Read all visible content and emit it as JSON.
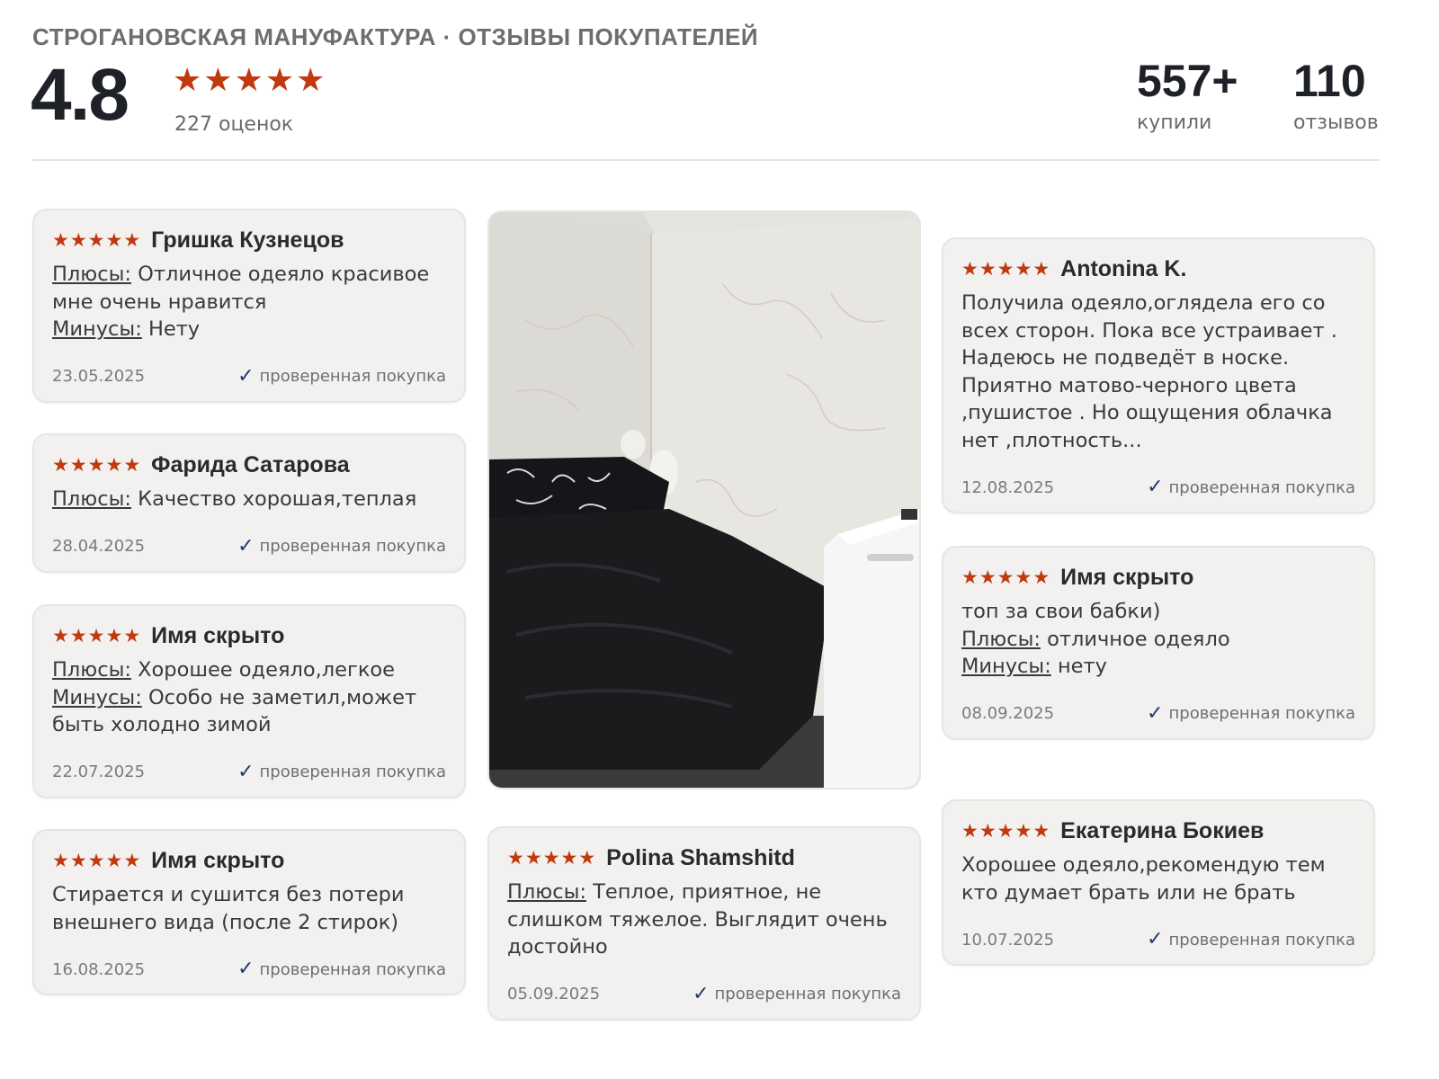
{
  "header": {
    "brand_title": "СТРОГАНОВСКАЯ МАНУФАКТУРА · ОТЗЫВЫ ПОКУПАТЕЛЕЙ",
    "score": "4.8",
    "score_stars": 5,
    "ratings_count": "227 оценок",
    "bought_value": "557+",
    "bought_label": "купили",
    "reviews_value": "110",
    "reviews_label": "отзывов"
  },
  "labels": {
    "pros": "Плюсы:",
    "cons": "Минусы:",
    "verified": "проверенная покупка"
  },
  "colors": {
    "star": "#c0390f",
    "check": "#1e3a6e",
    "card_bg": "#f2f1ef"
  },
  "reviews": [
    {
      "author": "Гришка Кузнецов",
      "stars": 5,
      "pros": "Отличное одеяло красивое мне очень нравится",
      "cons": "Нету",
      "date": "23.05.2025"
    },
    {
      "author": "Фарида Сатарова",
      "stars": 5,
      "pros": "Качество хорошая,теплая",
      "date": "28.04.2025"
    },
    {
      "author": "Имя скрыто",
      "stars": 5,
      "pros": "Хорошее одеяло,легкое",
      "cons": "Особо не заметил,может быть холодно зимой",
      "date": "22.07.2025"
    },
    {
      "author": "Имя скрыто",
      "stars": 5,
      "text": "Стирается и сушится без потери внешнего вида (после 2 стирок)",
      "date": "16.08.2025"
    },
    {
      "author": "Polina Shamshitd",
      "stars": 5,
      "pros": "Теплое, приятное, не слишком тяжелое. Выглядит очень достойно",
      "date": "05.09.2025"
    },
    {
      "author": "Antonina K.",
      "stars": 5,
      "text": "Получила одеяло,оглядела его со всех сторон. Пока все устраивает . Надеюсь не подведёт в носке. Приятно матово-черного цвета ,пушистое . Но ощущения облачка нет ,плотность...",
      "date": "12.08.2025"
    },
    {
      "author": "Имя скрыто",
      "stars": 5,
      "text": "топ за свои бабки)",
      "pros": "отличное одеяло",
      "cons": "нету",
      "date": "08.09.2025"
    },
    {
      "author": "Екатерина Бокиев",
      "stars": 5,
      "text": "Хорошее одеяло,рекомендую тем кто думает брать или не брать",
      "date": "10.07.2025"
    }
  ]
}
